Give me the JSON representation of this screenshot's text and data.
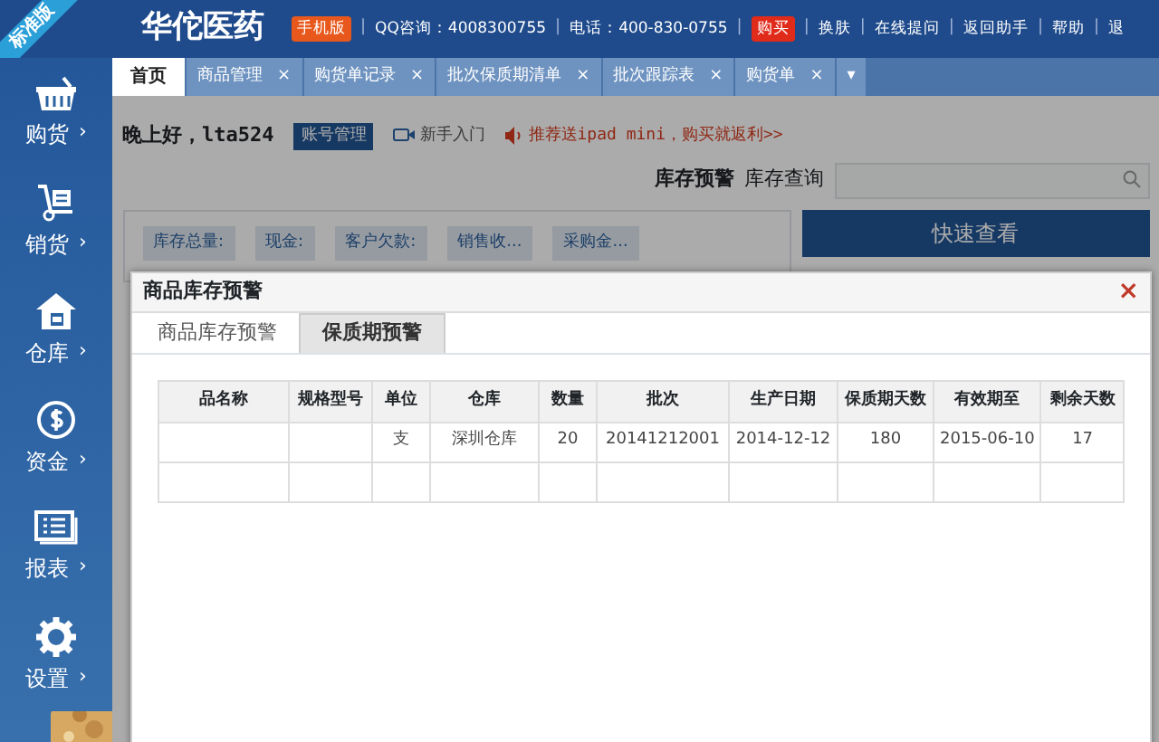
{
  "edition_ribbon": "标准版",
  "header": {
    "logo": "华佗医药",
    "links": [
      {
        "kind": "badge",
        "text": "手机版",
        "color": "#e8581c"
      },
      {
        "kind": "separator",
        "text": "|"
      },
      {
        "kind": "text",
        "text": "QQ咨询：4008300755"
      },
      {
        "kind": "separator",
        "text": "|"
      },
      {
        "kind": "text",
        "text": "电话：400-830-0755"
      },
      {
        "kind": "separator",
        "text": "|"
      },
      {
        "kind": "badge",
        "text": "购买",
        "color": "#e02a1a"
      },
      {
        "kind": "separator",
        "text": "|"
      },
      {
        "kind": "text",
        "text": "换肤"
      },
      {
        "kind": "separator",
        "text": "|"
      },
      {
        "kind": "text",
        "text": "在线提问"
      },
      {
        "kind": "separator",
        "text": "|"
      },
      {
        "kind": "text",
        "text": "返回助手"
      },
      {
        "kind": "separator",
        "text": "|"
      },
      {
        "kind": "text",
        "text": "帮助"
      },
      {
        "kind": "separator",
        "text": "|"
      },
      {
        "kind": "text",
        "text": "退"
      }
    ]
  },
  "sidebar": {
    "items": [
      {
        "label": "购货",
        "arrow": "›"
      },
      {
        "label": "销货",
        "arrow": "›"
      },
      {
        "label": "仓库",
        "arrow": "›"
      },
      {
        "label": "资金",
        "arrow": "›"
      },
      {
        "label": "报表",
        "arrow": "›"
      },
      {
        "label": "设置",
        "arrow": "›"
      }
    ]
  },
  "tabs": [
    {
      "label": "首页",
      "selected": true
    },
    {
      "label": "商品管理",
      "selected": false,
      "close": "×"
    },
    {
      "label": "购货单记录",
      "selected": false,
      "close": "×"
    },
    {
      "label": "批次保质期清单",
      "selected": false,
      "close": "×"
    },
    {
      "label": "批次跟踪表",
      "selected": false,
      "close": "×"
    },
    {
      "label": "购货单",
      "selected": false,
      "close": "×"
    }
  ],
  "tab_menu": "▾",
  "welcome": {
    "greeting": "晚上好，lta524",
    "account": "账号管理",
    "guide": "新手入门",
    "promo": "推荐送ipad mini，购买就返利>>"
  },
  "stock": {
    "alert": "库存预警",
    "query": "库存查询"
  },
  "summary": [
    "库存总量:",
    "现金:",
    "客户欠款:",
    "销售收...",
    "采购金..."
  ],
  "quick_view": "快速查看",
  "modal": {
    "title": "商品库存预警",
    "close": "×",
    "tabs": [
      {
        "label": "商品库存预警",
        "selected": false
      },
      {
        "label": "保质期预警",
        "selected": true
      }
    ],
    "table": {
      "columns": [
        "品名称",
        "规格型号",
        "单位",
        "仓库",
        "数量",
        "批次",
        "生产日期",
        "保质期天数",
        "有效期至",
        "剩余天数"
      ],
      "rows": [
        [
          null,
          null,
          "支",
          "深圳仓库",
          "20",
          "20141212001",
          "2014-12-12",
          "180",
          "2015-06-10",
          "17"
        ]
      ]
    }
  }
}
